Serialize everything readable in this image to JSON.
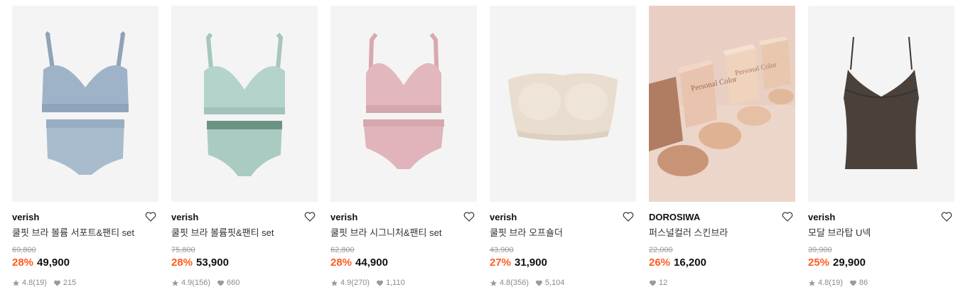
{
  "products": [
    {
      "brand": "verish",
      "name": "쿨핏 브라 볼륨 서포트&팬티 set",
      "original_price": "69,800",
      "discount": "28%",
      "price": "49,900",
      "rating": "4.8",
      "reviews": "(19)",
      "likes": "215",
      "color": "#9fb3c8",
      "bottom_color": "#a8bccd"
    },
    {
      "brand": "verish",
      "name": "쿨핏 브라 볼륨핏&팬티 set",
      "original_price": "75,800",
      "discount": "28%",
      "price": "53,900",
      "rating": "4.9",
      "reviews": "(156)",
      "likes": "660",
      "color": "#b4d3cc",
      "bottom_color": "#a9cbc1"
    },
    {
      "brand": "verish",
      "name": "쿨핏 브라 시그니처&팬티 set",
      "original_price": "62,800",
      "discount": "28%",
      "price": "44,900",
      "rating": "4.9",
      "reviews": "(270)",
      "likes": "1,110",
      "color": "#e2b7bd",
      "bottom_color": "#e0b4ba"
    },
    {
      "brand": "verish",
      "name": "쿨핏 브라 오프숄더",
      "original_price": "43,900",
      "discount": "27%",
      "price": "31,900",
      "rating": "4.8",
      "reviews": "(356)",
      "likes": "5,104",
      "color": "#e9ddcf"
    },
    {
      "brand": "DOROSIWA",
      "name": "퍼스널컬러 스킨브라",
      "original_price": "22,000",
      "discount": "26%",
      "price": "16,200",
      "rating": "",
      "reviews": "",
      "likes": "12",
      "color": "#e8cfc2"
    },
    {
      "brand": "verish",
      "name": "모달 브라탑 U넥",
      "original_price": "39,900",
      "discount": "25%",
      "price": "29,900",
      "rating": "4.8",
      "reviews": "(19)",
      "likes": "86",
      "color": "#4a413b"
    }
  ],
  "box_text": "Personal Color"
}
